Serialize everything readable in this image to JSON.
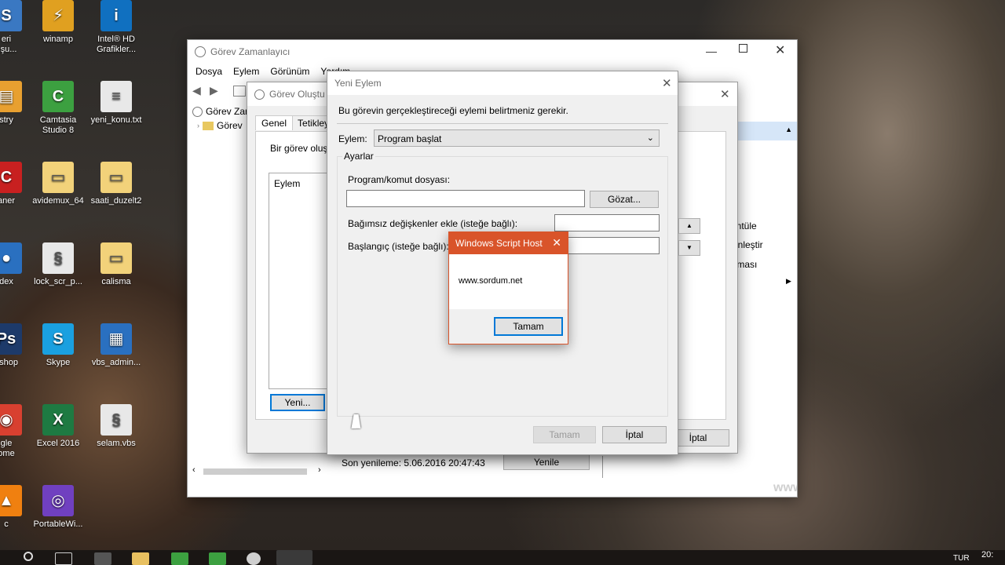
{
  "desktop": {
    "icons": [
      {
        "label": "eri\nuşu...",
        "color": "#3a78c2",
        "glyph": "S"
      },
      {
        "label": "winamp",
        "color": "#e0a020",
        "glyph": "⚡"
      },
      {
        "label": "Intel® HD\nGrafikler...",
        "color": "#1070c0",
        "glyph": "i"
      },
      {
        "label": "stry",
        "color": "#e8a030",
        "glyph": "▤"
      },
      {
        "label": "Camtasia\nStudio 8",
        "color": "#3ca040",
        "glyph": "C"
      },
      {
        "label": "yeni_konu.txt",
        "color": "#e8e8e8",
        "glyph": "≡"
      },
      {
        "label": "aner",
        "color": "#c82020",
        "glyph": "C"
      },
      {
        "label": "avidemux_64",
        "color": "#f2d27a",
        "glyph": "▭"
      },
      {
        "label": "saati_duzelt2",
        "color": "#f2d27a",
        "glyph": "▭"
      },
      {
        "label": "dex",
        "color": "#2a70c0",
        "glyph": "●"
      },
      {
        "label": "lock_scr_p...",
        "color": "#e8e8e8",
        "glyph": "§"
      },
      {
        "label": "calisma",
        "color": "#f2d27a",
        "glyph": "▭"
      },
      {
        "label": "oshop",
        "color": "#1d3a6a",
        "glyph": "Ps"
      },
      {
        "label": "Skype",
        "color": "#1aa0e0",
        "glyph": "S"
      },
      {
        "label": "vbs_admin...",
        "color": "#2a70c0",
        "glyph": "▦"
      },
      {
        "label": "gle\nome",
        "color": "#d84030",
        "glyph": "◉"
      },
      {
        "label": "Excel 2016",
        "color": "#1e7a42",
        "glyph": "X"
      },
      {
        "label": "selam.vbs",
        "color": "#e8e8e8",
        "glyph": "§"
      },
      {
        "label": "c",
        "color": "#f08010",
        "glyph": "▲"
      },
      {
        "label": "PortableWi...",
        "color": "#7040c0",
        "glyph": "◎"
      }
    ]
  },
  "task_scheduler": {
    "title": "Görev Zamanlayıcı",
    "menu": [
      "Dosya",
      "Eylem",
      "Görünüm",
      "Yardım"
    ],
    "tree_root": "Görev Zar",
    "tree_child": "Görev",
    "right_items": [
      "...",
      "üntüle",
      "kinleştir",
      "ırması"
    ],
    "status_text": "Son yenileme: 5.06.2016 20:47:43",
    "refresh_label": "Yenile",
    "watermark": "www.sordum.net"
  },
  "create_task": {
    "title": "Görev Oluştu",
    "tabs": [
      "Genel",
      "Tetikley"
    ],
    "desc": "Bir görev oluş",
    "list_header": "Eylem",
    "new_label": "Yeni...",
    "cancel_label": "İptal"
  },
  "new_action": {
    "title": "Yeni Eylem",
    "instruction": "Bu görevin gerçekleştireceği eylemi belirtmeniz gerekir.",
    "action_label": "Eylem:",
    "action_value": "Program başlat",
    "settings_label": "Ayarlar",
    "program_label": "Program/komut dosyası:",
    "program_value": "",
    "browse_label": "Gözat...",
    "args_label": "Bağımsız değişkenler ekle (isteğe bağlı):",
    "args_value": "",
    "start_label": "Başlangıç (isteğe bağlı):",
    "start_value": "",
    "ok_label": "Tamam",
    "cancel_label": "İptal"
  },
  "script_host": {
    "title": "Windows Script Host",
    "message": "www.sordum.net",
    "ok_label": "Tamam",
    "accent": "#d9542a"
  },
  "taskbar": {
    "lang": "TUR",
    "clock": "20:"
  }
}
